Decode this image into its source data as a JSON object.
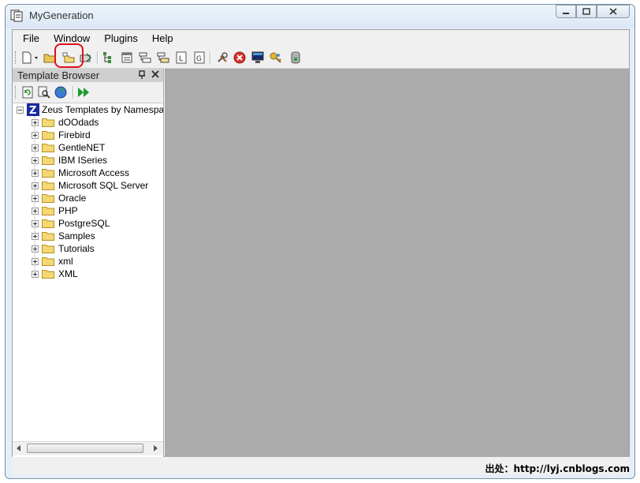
{
  "window": {
    "title": "MyGeneration"
  },
  "menu": [
    "File",
    "Window",
    "Plugins",
    "Help"
  ],
  "toolbar": {
    "icons": [
      "new-file-icon",
      "open-icon",
      "open-folder-icon",
      "save-icon",
      "tree-view-icon",
      "properties-icon",
      "hierarchy-icon",
      "db-map-icon",
      "language-l-icon",
      "generator-g-icon",
      "tools-icon",
      "stop-icon",
      "console-icon",
      "key-icon",
      "database-icon"
    ]
  },
  "template_browser": {
    "title": "Template Browser",
    "root_label": "Zeus Templates by Namespace",
    "folders": [
      "dOOdads",
      "Firebird",
      "GentleNET",
      "IBM ISeries",
      "Microsoft Access",
      "Microsoft SQL Server",
      "Oracle",
      "PHP",
      "PostgreSQL",
      "Samples",
      "Tutorials",
      "xml",
      "XML"
    ]
  },
  "status": {
    "watermark": "出处：http://lyj.cnblogs.com"
  },
  "colors": {
    "workspace": "#ababab",
    "highlight": "#e0101a",
    "folder": "#f3d874"
  }
}
